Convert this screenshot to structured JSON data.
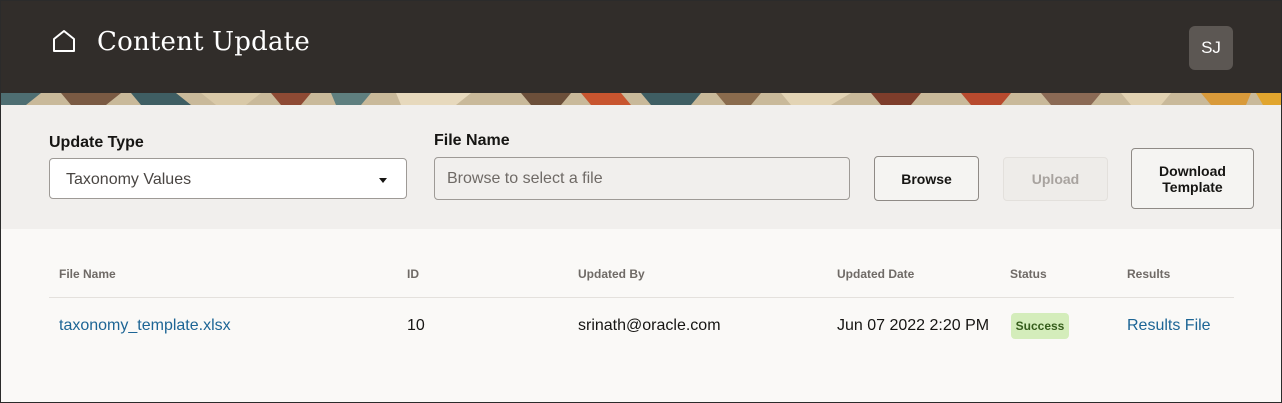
{
  "header": {
    "title": "Content Update",
    "avatar_initials": "SJ"
  },
  "form": {
    "update_type_label": "Update Type",
    "update_type_value": "Taxonomy Values",
    "file_name_label": "File Name",
    "file_name_placeholder": "Browse to select a file",
    "browse_label": "Browse",
    "upload_label": "Upload",
    "upload_disabled": true,
    "download_label": "Download Template"
  },
  "table": {
    "columns": [
      "File Name",
      "ID",
      "Updated By",
      "Updated Date",
      "Status",
      "Results"
    ],
    "rows": [
      {
        "file_name": "taxonomy_template.xlsx",
        "id": "10",
        "updated_by": "srinath@oracle.com",
        "updated_date": "Jun 07 2022 2:20 PM",
        "status": "Success",
        "results": "Results File"
      }
    ]
  },
  "colors": {
    "header_bg": "#312d2a",
    "toolbar_bg": "#f1efed",
    "link": "#1d6595",
    "success_bg": "#d4edbb",
    "success_text": "#365e1c"
  },
  "icons": {
    "home": "home-icon",
    "dropdown": "chevron-down-icon"
  }
}
